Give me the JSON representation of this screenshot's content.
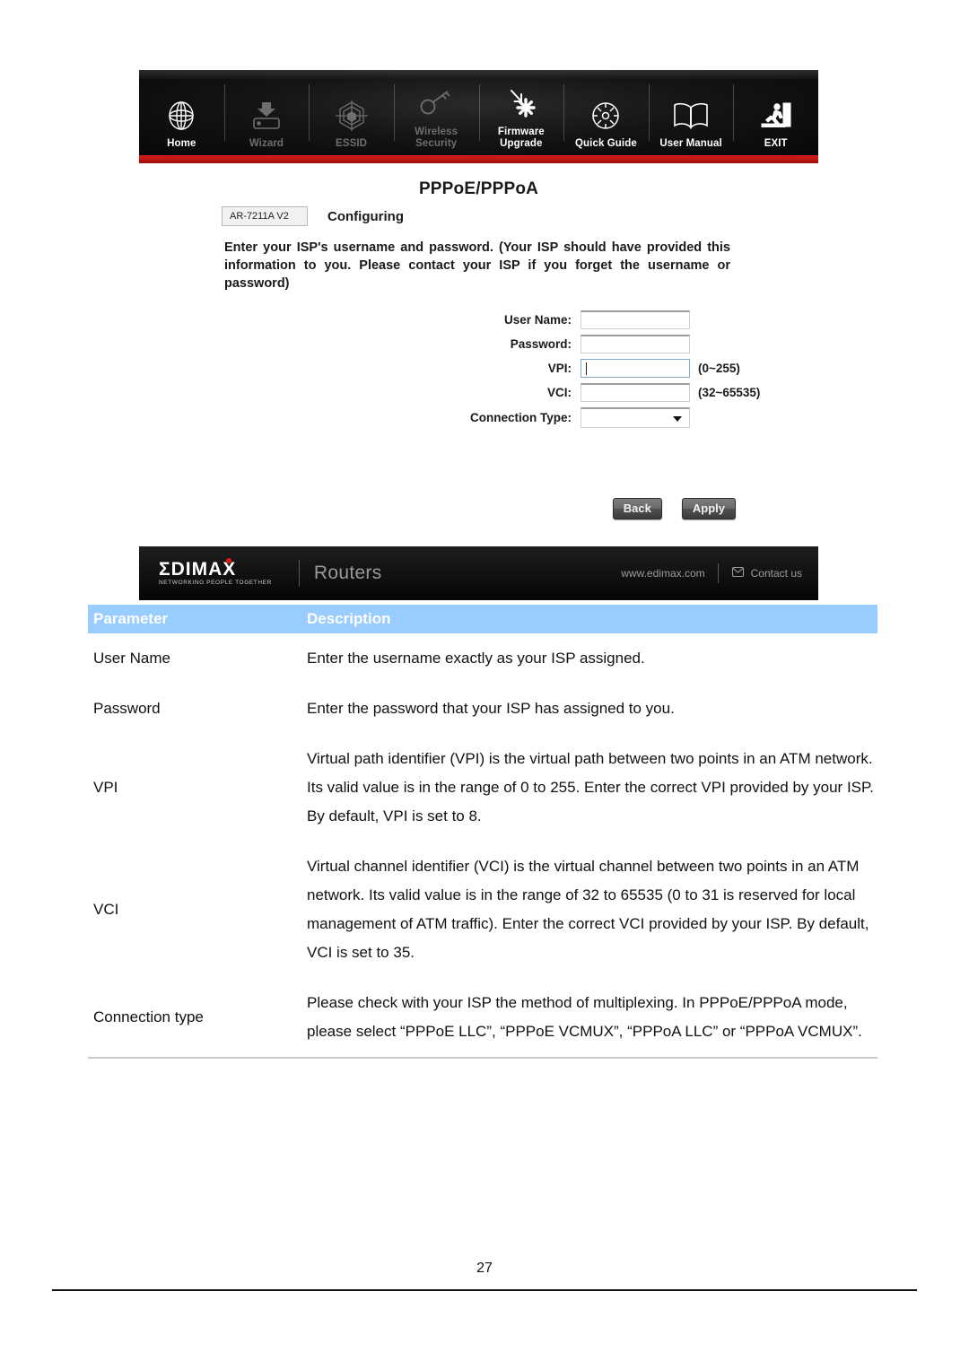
{
  "router_ui": {
    "nav": [
      {
        "label": "Home",
        "icon": "globe-icon",
        "active": true
      },
      {
        "label": "Wizard",
        "icon": "wizard-download-icon",
        "active": false
      },
      {
        "label": "ESSID",
        "icon": "essid-web-icon",
        "active": false
      },
      {
        "label": "Wireless\nSecurity",
        "icon": "key-icon",
        "active": false
      },
      {
        "label": "Firmware\nUpgrade",
        "icon": "firmware-upgrade-icon",
        "active": true
      },
      {
        "label": "Quick Guide",
        "icon": "compass-icon",
        "active": true
      },
      {
        "label": "User Manual",
        "icon": "open-book-icon",
        "active": true
      },
      {
        "label": "EXIT",
        "icon": "exit-running-icon",
        "active": true
      }
    ],
    "page_title": "PPPoE/PPPoA",
    "model_badge": "AR-7211A V2",
    "status": "Configuring",
    "intro": "Enter your ISP's username and password. (Your ISP should have provided this information to you. Please contact your ISP if you forget the username or password)",
    "fields": [
      {
        "label": "User Name:",
        "value": "",
        "hint": "",
        "type": "text",
        "focused": false
      },
      {
        "label": "Password:",
        "value": "",
        "hint": "",
        "type": "text",
        "focused": false
      },
      {
        "label": "VPI:",
        "value": "",
        "hint": "(0~255)",
        "type": "text",
        "focused": true
      },
      {
        "label": "VCI:",
        "value": "",
        "hint": "(32~65535)",
        "type": "text",
        "focused": false
      },
      {
        "label": "Connection Type:",
        "value": "",
        "hint": "",
        "type": "select",
        "focused": false
      }
    ],
    "buttons": {
      "back": "Back",
      "apply": "Apply"
    },
    "footer": {
      "brand": "ΣDIMAX",
      "brand_tagline": "NETWORKING PEOPLE TOGETHER",
      "category": "Routers",
      "website": "www.edimax.com",
      "contact": "Contact us"
    },
    "accent_red": "#d81b1b"
  },
  "parameter_table": {
    "headers": [
      "Parameter",
      "Description"
    ],
    "header_bg": "#99ccff",
    "rows": [
      {
        "parameter": "User Name",
        "description": "Enter the username exactly as your ISP assigned."
      },
      {
        "parameter": "Password",
        "description": "Enter the password that your ISP has assigned to you."
      },
      {
        "parameter": "VPI",
        "description": "Virtual path identifier (VPI) is the virtual path between two points in an ATM network. Its valid value is in the range of 0 to 255. Enter the correct VPI provided by your ISP. By default, VPI is set to 8."
      },
      {
        "parameter": "VCI",
        "description": "Virtual channel identifier (VCI) is the virtual channel between two points in an ATM network. Its valid value is in the range of 32 to 65535 (0 to 31 is reserved for local management of ATM traffic). Enter the correct VCI provided by your ISP. By default, VCI is set to 35."
      },
      {
        "parameter": "Connection type",
        "description": "Please check with your ISP the method of multiplexing. In PPPoE/PPPoA mode, please select “PPPoE LLC”, “PPPoE VCMUX”, “PPPoA LLC” or “PPPoA VCMUX”."
      }
    ]
  },
  "page_footer": {
    "page_number": "27"
  }
}
